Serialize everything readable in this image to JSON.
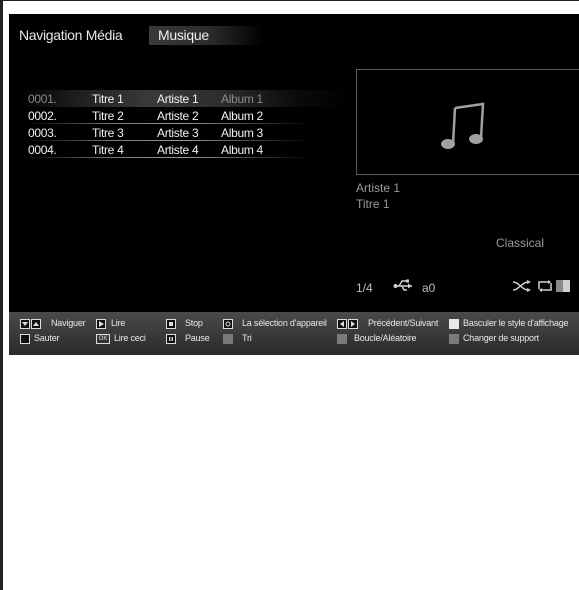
{
  "header": {
    "title": "Navigation Média",
    "tab": "Musique"
  },
  "tracks": [
    {
      "num": "0001.",
      "title": "Titre 1",
      "artist": "Artiste 1",
      "album": "Album 1"
    },
    {
      "num": "0002.",
      "title": "Titre 2",
      "artist": "Artiste 2",
      "album": "Album 2"
    },
    {
      "num": "0003.",
      "title": "Titre 3",
      "artist": "Artiste 3",
      "album": "Album 3"
    },
    {
      "num": "0004.",
      "title": "Titre 4",
      "artist": "Artiste 4",
      "album": "Album 4"
    }
  ],
  "selected_index": 0,
  "now_playing": {
    "artist": "Artiste 1",
    "title": "Titre 1",
    "genre": "Classical"
  },
  "status": {
    "page": "1/4",
    "device": "a0"
  },
  "legend": {
    "navigate": "Naviguer",
    "skip": "Sauter",
    "play": "Lire",
    "play_this": "Lire ceci",
    "ok_key": "OK",
    "stop": "Stop",
    "pause": "Pause",
    "device_select": "La sélection d'appareil",
    "sort": "Tri",
    "prev_next": "Précédent/Suivant",
    "loop_shuffle": "Boucle/Aléatoire",
    "toggle_style": "Basculer le style d'affichage",
    "change_source": "Changer de support"
  },
  "colors": {
    "background": "#000000",
    "legend_bar": "#3a3a3a",
    "text": "#f2f2f2",
    "muted": "#9a9a9a"
  },
  "icons": [
    "music-note-icon",
    "usb-icon",
    "shuffle-icon",
    "repeat-icon"
  ]
}
